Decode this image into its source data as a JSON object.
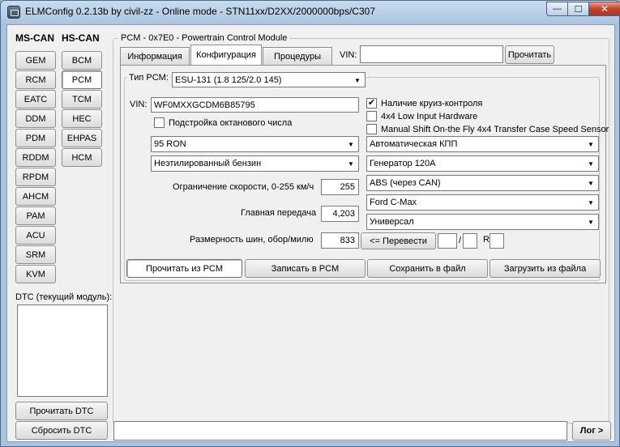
{
  "window": {
    "title": "ELMConfig 0.2.13b by civil-zz - Online mode - STN11xx/D2XX/2000000bps/C307",
    "min_glyph": "—",
    "max_glyph": "☐",
    "close_glyph": "✕"
  },
  "left": {
    "ms_can_header": "MS-CAN",
    "hs_can_header": "HS-CAN",
    "ms_can_modules": [
      "GEM",
      "RCM",
      "EATC",
      "DDM",
      "PDM",
      "RDDM",
      "RPDM",
      "AHCM",
      "PAM",
      "ACU",
      "SRM",
      "KVM"
    ],
    "hs_can_modules": [
      "BCM",
      "PCM",
      "TCM",
      "HEC",
      "EHPAS",
      "HCM"
    ],
    "selected_module": "PCM",
    "dtc_label": "DTC (текущий модуль):",
    "read_dtc": "Прочитать DTC",
    "clear_dtc": "Сбросить DTC"
  },
  "main": {
    "group_title": "PCM - 0x7E0 - Powertrain Control Module",
    "tabs": [
      "Информация",
      "Конфигурация",
      "Процедуры"
    ],
    "active_tab": "Конфигурация",
    "vin_label": "VIN:",
    "vin_value": "",
    "read_vin": "Прочитать",
    "pcm_type_label": "Тип PCM:",
    "pcm_type_value": "ESU-131 (1.8 125/2.0 145)",
    "config_vin_label": "VIN:",
    "config_vin_value": "WF0MXXGCDM6B85795",
    "octane_adjust": "Подстройка октанового числа",
    "octane_checked": false,
    "fuel_octane": "95 RON",
    "fuel_type": "Неэтилированный бензин",
    "speed_limit_label": "Ограничение скорости, 0-255 км/ч",
    "speed_limit_value": "255",
    "final_drive_label": "Главная передача",
    "final_drive_value": "4,203",
    "tire_label": "Размерность шин, обор/милю",
    "tire_value": "833",
    "convert_button": "<= Перевести",
    "slash": "/",
    "r_label": "R",
    "cruise_control": "Наличие круиз-контроля",
    "cruise_checked": true,
    "low_input_hw": "4x4 Low Input Hardware",
    "low_input_checked": false,
    "manual_shift": "Manual Shift On-the Fly 4x4 Transfer Case Speed Sensor",
    "manual_shift_checked": false,
    "transmission": "Автоматическая КПП",
    "generator": "Генератор 120А",
    "abs": "ABS (через CAN)",
    "model": "Ford C-Max",
    "body": "Универсал",
    "read_pcm": "Прочитать из PCM",
    "write_pcm": "Записать в PCM",
    "save_file": "Сохранить в файл",
    "load_file": "Загрузить из файла"
  },
  "footer": {
    "status_text": "",
    "log_button": "Лог >"
  }
}
